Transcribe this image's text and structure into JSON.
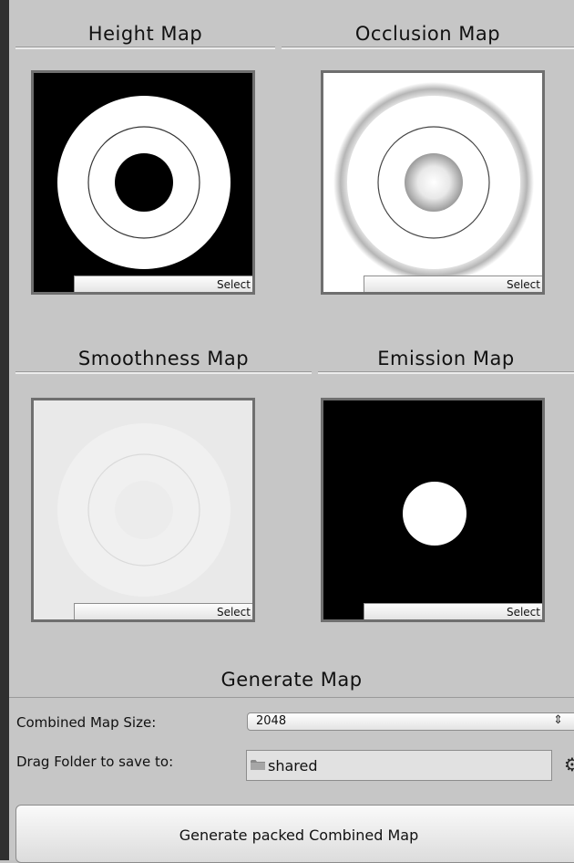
{
  "maps": {
    "height": {
      "title": "Height Map",
      "select_label": "Select"
    },
    "occlusion": {
      "title": "Occlusion Map",
      "select_label": "Select"
    },
    "smoothness": {
      "title": "Smoothness Map",
      "select_label": "Select"
    },
    "emission": {
      "title": "Emission Map",
      "select_label": "Select"
    }
  },
  "generate": {
    "title": "Generate Map",
    "size_label": "Combined Map Size:",
    "size_value": "2048",
    "folder_label": "Drag Folder to save to:",
    "folder_value": "shared",
    "button_label": "Generate packed Combined Map"
  },
  "icons": {
    "folder": "folder-icon",
    "dropdown": "dropdown-arrow-icon",
    "settings": "gear-icon"
  },
  "colors": {
    "panel_bg": "#c6c6c6",
    "edge": "#2f2f2f"
  }
}
